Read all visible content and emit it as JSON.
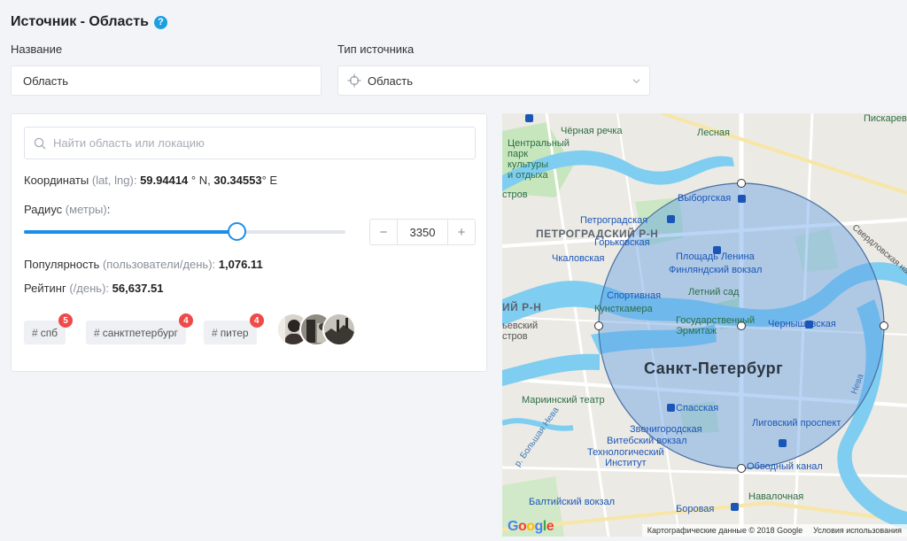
{
  "header": {
    "title": "Источник - Область",
    "help_icon": "?"
  },
  "form": {
    "name_label": "Название",
    "name_value": "Область",
    "type_label": "Тип источника",
    "type_value": "Область"
  },
  "panel": {
    "search_placeholder": "Найти область или локацию",
    "coords_label": "Координаты",
    "coords_unit": "(lat, lng):",
    "coords_lat": "59.94414",
    "coords_lat_suffix": "° N,",
    "coords_lng": "30.34553",
    "coords_lng_suffix": "° E",
    "radius_label": "Радиус",
    "radius_unit": "(метры)",
    "radius_colon": ":",
    "radius_value": "3350",
    "radius_slider_fraction": 0.66,
    "stepper_minus": "−",
    "stepper_plus": "+",
    "popularity_label": "Популярность",
    "popularity_unit": "(пользователи/день):",
    "popularity_value": "1,076.11",
    "rating_label": "Рейтинг",
    "rating_unit": "(/день):",
    "rating_value": "56,637.51",
    "tags": [
      {
        "label": "спб",
        "count": "5"
      },
      {
        "label": "санктпетербург",
        "count": "4"
      },
      {
        "label": "питер",
        "count": "4"
      }
    ]
  },
  "map": {
    "labels": {
      "piskarevka": "Пискарев",
      "chernaya": "Чёрная речка",
      "lesnaya": "Лесная",
      "central_park": "Центральный\nпарк\nкультуры\nи отдыха",
      "ostrov": "стров",
      "vyborgskaya": "Выборгская",
      "petrogradskaya": "Петроградская",
      "petrograd_district": "ПЕТРОГРАДСКИЙ Р-Н",
      "gorkovskaya": "Горьковская",
      "chkalovskaya": "Чкаловская",
      "ploshchad_lenina": "Площадь Ленина",
      "finlyandsky": "Финляндский вокзал",
      "sverdlovskaya": "Свердловская наб",
      "letny_sad": "Летний сад",
      "sportivnaya": "Спортивная",
      "kunstkamera": "Кунсткамера",
      "ermitazh": "Государственный\nЭрмитаж",
      "chernyshevskaya": "Чернышевская",
      "vas_district": "ИЙ Р-Н",
      "vas_label": "ьевский\nстров",
      "city": "Санкт-Петербург",
      "mariinsky": "Мариинский театр",
      "spasskaya": "Спасская",
      "nevsky": "Нева",
      "bolshaya_neva": "р. Большая Нева",
      "ligovsky": "Лиговский проспект",
      "zvenigorodskaya": "Звенигородская",
      "vitebsky": "Витебский вокзал",
      "tech_inst": "Технологический\nИнститут",
      "obvodny": "Обводный канал",
      "baltiysky": "Балтийский вокзал",
      "borovaya": "Боровая",
      "navalochnaya": "Навалочная"
    },
    "attribution": "Картографические данные © 2018 Google",
    "terms": "Условия использования",
    "logo": "Google"
  }
}
